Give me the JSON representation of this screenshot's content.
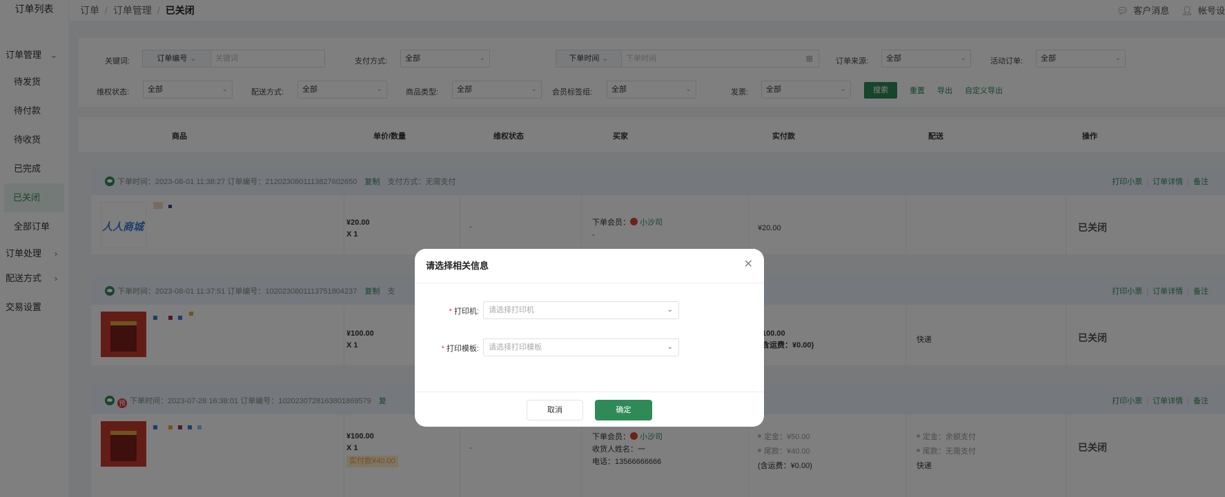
{
  "sidebar": {
    "title": "订单列表",
    "group_order_mgmt": "订单管理",
    "items": [
      "待发货",
      "待付款",
      "待收货",
      "已完成",
      "已关闭",
      "全部订单"
    ],
    "group_order_process": "订单处理",
    "group_delivery": "配送方式",
    "group_trade": "交易设置"
  },
  "breadcrumb": {
    "level1": "订单",
    "level2": "订单管理",
    "current": "已关闭"
  },
  "topbar": {
    "messages": "客户消息",
    "account": "帐号设"
  },
  "filters": {
    "keyword_label": "关键词:",
    "keyword_type": "订单编号",
    "keyword_placeholder": "关键词",
    "payment_label": "支付方式:",
    "payment_value": "全部",
    "time_type": "下单时间",
    "time_placeholder": "下单时间",
    "source_label": "订单来源:",
    "source_value": "全部",
    "activity_label": "活动订单:",
    "activity_value": "全部",
    "rights_label": "维权状态:",
    "rights_value": "全部",
    "delivery_label": "配送方式:",
    "delivery_value": "全部",
    "goods_type_label": "商品类型:",
    "goods_type_value": "全部",
    "member_tag_label": "会员标签组:",
    "member_tag_value": "全部",
    "invoice_label": "发票:",
    "invoice_value": "全部",
    "search_btn": "搜索",
    "reset": "重置",
    "export": "导出",
    "custom_export": "自定义导出"
  },
  "table_headers": [
    "商品",
    "单价/数量",
    "维权状态",
    "买家",
    "实付款",
    "配送",
    "操作"
  ],
  "row_actions": {
    "print": "打印小票",
    "detail": "订单详情",
    "remark": "备注"
  },
  "orders": [
    {
      "head": "下单时间：2023-08-01 11:38:27   订单编号：2120230801113827602650",
      "copy": "复制",
      "pay": "支付方式：无需支付",
      "thumb_text": "人人商城",
      "price": "¥20.00",
      "qty": "X 1",
      "rights": "-",
      "buyer_label": "下单会员：",
      "buyer_name": "小沙司",
      "buyer_extra": "-",
      "paid": "¥20.00",
      "status": "已关闭"
    },
    {
      "head": "下单时间：2023-08-01 11:37:51   订单编号：1020230801113751804237",
      "copy": "复制",
      "pay": "支",
      "price": "¥100.00",
      "qty": "X 1",
      "paid": "100.00",
      "paid_ship": "含运费：¥0.00)",
      "ship": "快递",
      "status": "已关闭"
    },
    {
      "prefix": "预",
      "head": "下单时间：2023-07-28 16:38:01   订单编号：1020230728163801869579",
      "copy": "复",
      "price": "¥100.00",
      "qty": "X 1",
      "paid_tag": "实付款¥40.00",
      "rights": "-",
      "buyer_label": "下单会员：",
      "buyer_name": "小沙司",
      "receiver": "收货人姓名：一",
      "phone": "电话：13566666666",
      "deposit": "定金：¥50.00",
      "balance": "尾款：¥40.00",
      "ship_fee": "(含运费：¥0.00)",
      "deposit_pay": "定金：余额支付",
      "balance_pay": "尾款：无需支付",
      "ship": "快递",
      "status": "已关闭"
    }
  ],
  "modal": {
    "title": "请选择相关信息",
    "printer_label": "打印机:",
    "printer_placeholder": "请选择打印机",
    "template_label": "打印模板:",
    "template_placeholder": "请选择打印模板",
    "cancel": "取消",
    "confirm": "确定"
  }
}
